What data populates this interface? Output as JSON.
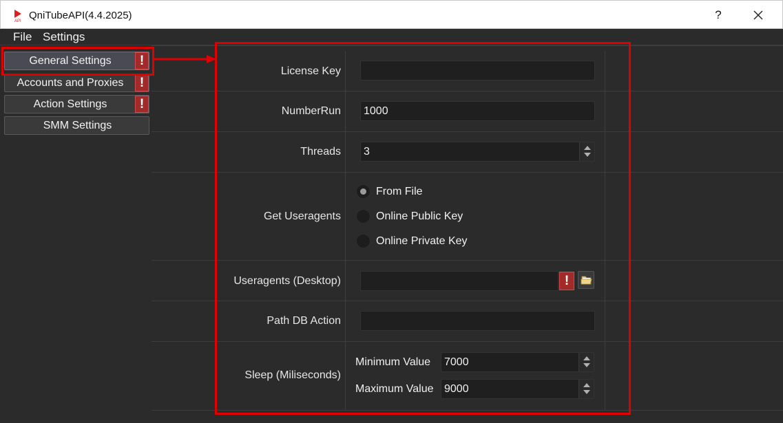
{
  "window": {
    "title": "QniTubeAPI(4.4.2025)",
    "icon": "app-logo-icon",
    "help_label": "?",
    "close_icon": "close-icon"
  },
  "menu": {
    "items": [
      {
        "label": "File"
      },
      {
        "label": "Settings"
      }
    ]
  },
  "sidebar": {
    "items": [
      {
        "label": "General Settings",
        "warning": "!",
        "active": true
      },
      {
        "label": "Accounts and Proxies",
        "warning": "!"
      },
      {
        "label": "Action Settings",
        "warning": "!"
      },
      {
        "label": "SMM Settings"
      }
    ]
  },
  "form": {
    "license_key": {
      "label": "License Key",
      "value": ""
    },
    "number_run": {
      "label": "NumberRun",
      "value": "1000"
    },
    "threads": {
      "label": "Threads",
      "value": "3"
    },
    "useragents_source": {
      "label": "Get Useragents",
      "options": [
        {
          "label": "From File",
          "checked": true
        },
        {
          "label": "Online Public Key",
          "checked": false
        },
        {
          "label": "Online Private Key",
          "checked": false
        }
      ]
    },
    "useragents_desktop": {
      "label": "Useragents (Desktop)",
      "value": "",
      "warning": "!",
      "browse_icon": "folder-icon"
    },
    "path_db_action": {
      "label": "Path DB Action",
      "value": ""
    },
    "sleep": {
      "label": "Sleep (Miliseconds)",
      "min_label": "Minimum Value",
      "min_value": "7000",
      "max_label": "Maximum Value",
      "max_value": "9000"
    }
  },
  "colors": {
    "highlight": "#e00000",
    "warning": "#a12a2a",
    "background": "#2b2b2b"
  }
}
